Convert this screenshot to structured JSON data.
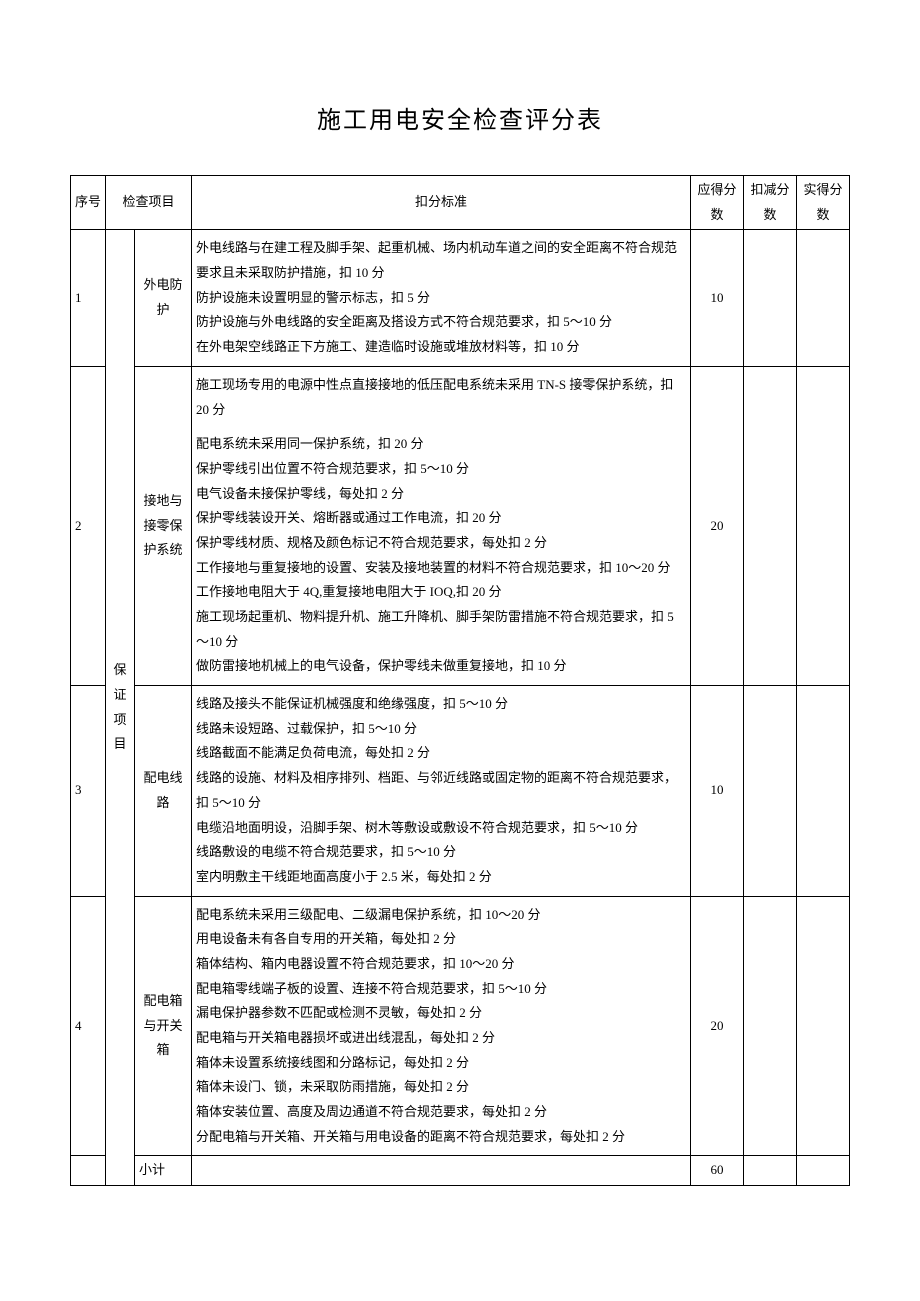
{
  "title": "施工用电安全检查评分表",
  "headers": {
    "seq": "序号",
    "item": "检查项目",
    "criteria": "扣分标准",
    "full": "应得分数",
    "deduct": "扣减分数",
    "actual": "实得分数"
  },
  "category": "保证项目",
  "rows": [
    {
      "seq": "1",
      "sub": "外电防护",
      "criteria": [
        "外电线路与在建工程及脚手架、起重机械、场内机动车道之间的安全距离不符合规范要求且未采取防护措施，扣 10 分",
        "防护设施未设置明显的警示标志，扣 5 分",
        "防护设施与外电线路的安全距离及搭设方式不符合规范要求，扣 5～10 分",
        "在外电架空线路正下方施工、建造临时设施或堆放材料等，扣 10 分"
      ],
      "full": "10"
    },
    {
      "seq": "2",
      "sub": "接地与接零保护系统",
      "criteria": [
        "施工现场专用的电源中性点直接接地的低压配电系统未采用 TN-S 接零保护系统，扣 20 分",
        "配电系统未采用同一保护系统，扣 20 分",
        "保护零线引出位置不符合规范要求，扣 5～10 分",
        "电气设备未接保护零线，每处扣 2 分",
        "保护零线装设开关、熔断器或通过工作电流，扣 20 分",
        "保护零线材质、规格及颜色标记不符合规范要求，每处扣 2 分",
        "工作接地与重复接地的设置、安装及接地装置的材料不符合规范要求，扣 10～20 分",
        "工作接地电阻大于 4Q,重复接地电阻大于 IOQ,扣 20 分",
        "施工现场起重机、物料提升机、施工升降机、脚手架防雷措施不符合规范要求，扣 5～10 分",
        "做防雷接地机械上的电气设备，保护零线未做重复接地，扣 10 分"
      ],
      "full": "20"
    },
    {
      "seq": "3",
      "sub": "配电线路",
      "criteria": [
        "线路及接头不能保证机械强度和绝缘强度，扣 5～10 分",
        "线路未设短路、过载保护，扣 5～10 分",
        "线路截面不能满足负荷电流，每处扣 2 分",
        "线路的设施、材料及相序排列、档距、与邻近线路或固定物的距离不符合规范要求，扣 5～10 分",
        "电缆沿地面明设，沿脚手架、树木等敷设或敷设不符合规范要求，扣 5～10 分",
        "线路敷设的电缆不符合规范要求，扣 5～10 分",
        "室内明敷主干线距地面高度小于 2.5 米，每处扣 2 分"
      ],
      "full": "10"
    },
    {
      "seq": "4",
      "sub": "配电箱与开关箱",
      "criteria": [
        "配电系统未采用三级配电、二级漏电保护系统，扣 10～20 分",
        "用电设备未有各自专用的开关箱，每处扣 2 分",
        "箱体结构、箱内电器设置不符合规范要求，扣 10～20 分",
        "配电箱零线端子板的设置、连接不符合规范要求，扣 5～10 分",
        "漏电保护器参数不匹配或检测不灵敏，每处扣 2 分",
        "配电箱与开关箱电器损坏或进出线混乱，每处扣 2 分",
        "箱体未设置系统接线图和分路标记，每处扣 2 分",
        "箱体未设门、锁，未采取防雨措施，每处扣 2 分",
        "箱体安装位置、高度及周边通道不符合规范要求，每处扣 2 分",
        "分配电箱与开关箱、开关箱与用电设备的距离不符合规范要求，每处扣 2 分"
      ],
      "full": "20"
    }
  ],
  "subtotal": {
    "label": "小计",
    "full": "60"
  }
}
